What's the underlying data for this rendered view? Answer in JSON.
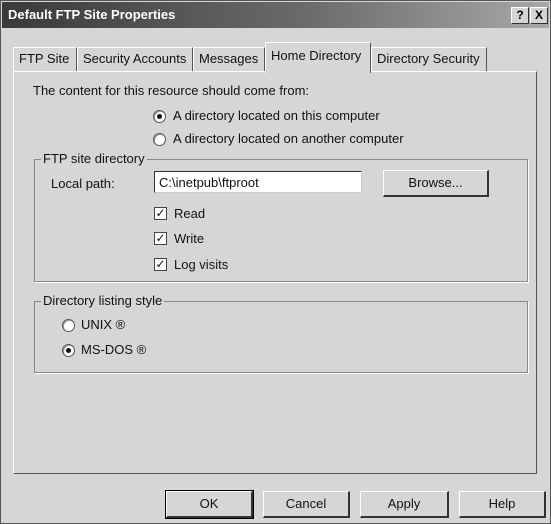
{
  "window": {
    "title": "Default FTP Site Properties",
    "help_glyph": "?",
    "close_glyph": "X"
  },
  "tabs": [
    {
      "label": "FTP Site",
      "active": false
    },
    {
      "label": "Security Accounts",
      "active": false
    },
    {
      "label": "Messages",
      "active": false
    },
    {
      "label": "Home Directory",
      "active": true
    },
    {
      "label": "Directory Security",
      "active": false
    }
  ],
  "content_source": {
    "prompt": "The content for this resource should come from:",
    "options": [
      {
        "label": "A directory located on this computer",
        "selected": true
      },
      {
        "label": "A directory located on another computer",
        "selected": false
      }
    ]
  },
  "ftp_site_directory": {
    "legend": "FTP site directory",
    "local_path_label": "Local path:",
    "local_path_value": "C:\\inetpub\\ftproot",
    "browse_label": "Browse...",
    "permissions": [
      {
        "label": "Read",
        "checked": true
      },
      {
        "label": "Write",
        "checked": true
      },
      {
        "label": "Log visits",
        "checked": true
      }
    ],
    "check_glyph": "✓"
  },
  "listing_style": {
    "legend": "Directory listing style",
    "options": [
      {
        "label": "UNIX ®",
        "selected": false
      },
      {
        "label": "MS-DOS ®",
        "selected": true
      }
    ]
  },
  "footer": {
    "ok_label": "OK",
    "cancel_label": "Cancel",
    "apply_label": "Apply",
    "help_label": "Help"
  }
}
